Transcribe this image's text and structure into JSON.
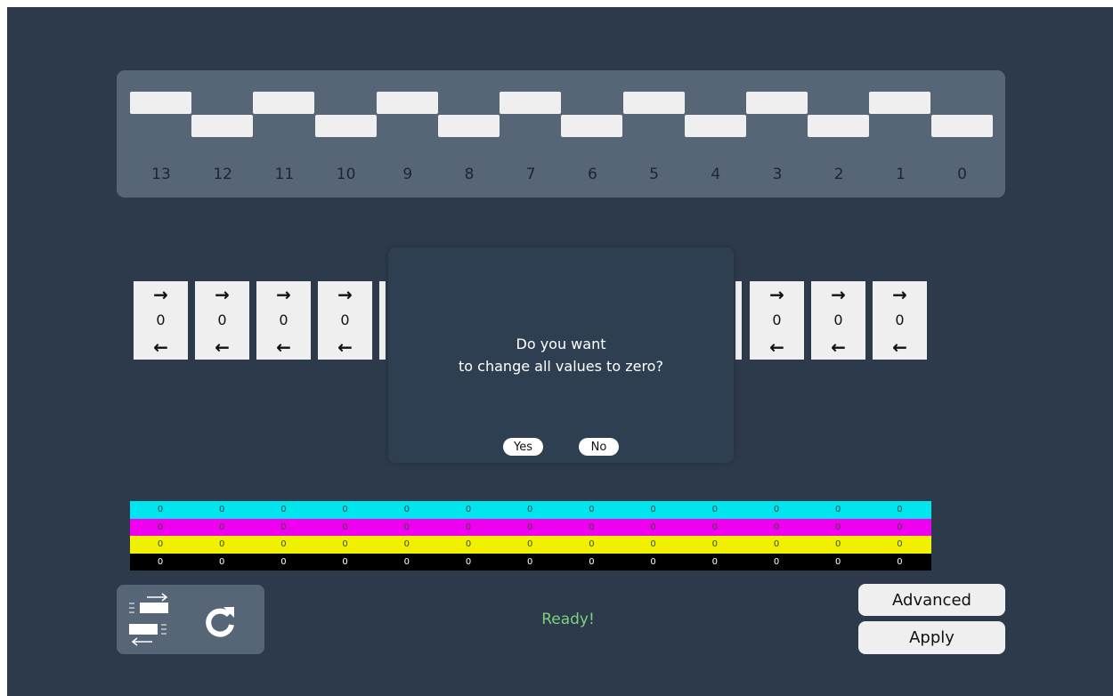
{
  "ruler": {
    "labels": [
      "13",
      "12",
      "11",
      "10",
      "9",
      "8",
      "7",
      "6",
      "5",
      "4",
      "3",
      "2",
      "1",
      "0"
    ]
  },
  "cards": {
    "left": [
      {
        "right_arrow": "➔",
        "value": "0",
        "left_arrow": "🡐"
      },
      {
        "right_arrow": "➔",
        "value": "0",
        "left_arrow": "🡐"
      },
      {
        "right_arrow": "➔",
        "value": "0",
        "left_arrow": "🡐"
      },
      {
        "right_arrow": "➔",
        "value": "0",
        "left_arrow": "🡐"
      }
    ],
    "right": [
      {
        "right_arrow": "➔",
        "value": "0",
        "left_arrow": "🡐"
      },
      {
        "right_arrow": "➔",
        "value": "0",
        "left_arrow": "🡐"
      },
      {
        "right_arrow": "➔",
        "value": "0",
        "left_arrow": "🡐"
      }
    ]
  },
  "dialog": {
    "line1": "Do you want",
    "line2": "to change all values to zero?",
    "yes_label": "Yes",
    "no_label": "No"
  },
  "color_bars": [
    {
      "color": "cyan",
      "hex": "#00e5ee",
      "text_color": "#444444",
      "values": [
        "0",
        "0",
        "0",
        "0",
        "0",
        "0",
        "0",
        "0",
        "0",
        "0",
        "0",
        "0",
        "0"
      ]
    },
    {
      "color": "magenta",
      "hex": "#f000f0",
      "text_color": "#444444",
      "values": [
        "0",
        "0",
        "0",
        "0",
        "0",
        "0",
        "0",
        "0",
        "0",
        "0",
        "0",
        "0",
        "0"
      ]
    },
    {
      "color": "yellow",
      "hex": "#f0f000",
      "text_color": "#444444",
      "values": [
        "0",
        "0",
        "0",
        "0",
        "0",
        "0",
        "0",
        "0",
        "0",
        "0",
        "0",
        "0",
        "0"
      ]
    },
    {
      "color": "black",
      "hex": "#000000",
      "text_color": "#ffffff",
      "values": [
        "0",
        "0",
        "0",
        "0",
        "0",
        "0",
        "0",
        "0",
        "0",
        "0",
        "0",
        "0",
        "0"
      ]
    }
  ],
  "toolbar": {
    "swap_icon": "swap-direction-icon",
    "reset_icon": "refresh-icon"
  },
  "status": "Ready!",
  "buttons": {
    "advanced_label": "Advanced",
    "apply_label": "Apply"
  },
  "colors": {
    "background": "#2c3a4b",
    "panel": "#566677",
    "dialog": "#2f3f52",
    "status_green": "#7ed17e"
  }
}
